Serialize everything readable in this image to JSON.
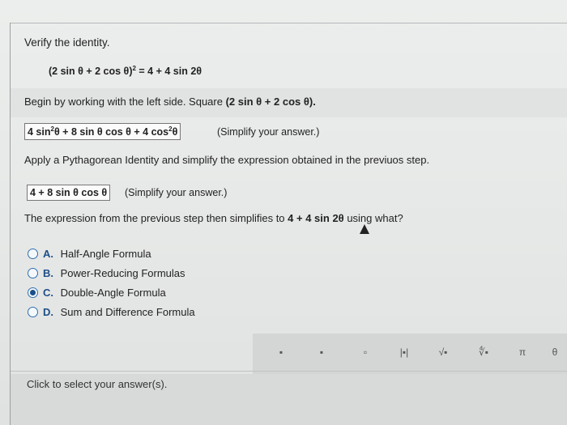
{
  "question": {
    "title": "Verify the identity.",
    "identity": {
      "lhs": "(2 sin θ + 2 cos θ)",
      "exp": "2",
      "rhs": " = 4 + 4 sin 2θ"
    }
  },
  "step1": {
    "prompt_prefix": "Begin by working with the left side. Square ",
    "prompt_expr": "(2 sin θ + 2 cos θ).",
    "answer_parts": [
      "4 sin",
      "2",
      "θ + 8 sin θ cos θ + 4 cos",
      "2",
      "θ"
    ],
    "hint": "(Simplify your answer.)"
  },
  "step2": {
    "prompt": "Apply a Pythagorean Identity and simplify the expression obtained in the previuos step.",
    "answer": "4 + 8 sin θ cos θ",
    "hint": "(Simplify your answer.)"
  },
  "step3": {
    "prompt_prefix": "The expression from the previous step then simplifies to ",
    "prompt_expr": "4 + 4 sin 2θ",
    "prompt_suffix": " using what?",
    "options": [
      {
        "letter": "A.",
        "label": "Half-Angle Formula",
        "selected": false
      },
      {
        "letter": "B.",
        "label": "Power-Reducing Formulas",
        "selected": false
      },
      {
        "letter": "C.",
        "label": "Double-Angle Formula",
        "selected": true
      },
      {
        "letter": "D.",
        "label": "Sum and Difference Formula",
        "selected": false
      }
    ]
  },
  "palette": {
    "buttons": [
      {
        "icon": "fraction-icon",
        "glyph": "▪"
      },
      {
        "icon": "mixed-number-icon",
        "glyph": "▪"
      },
      {
        "icon": "exponent-icon",
        "glyph": "▫"
      },
      {
        "icon": "absolute-value-icon",
        "glyph": "|▪|"
      },
      {
        "icon": "square-root-icon",
        "glyph": "√▪"
      },
      {
        "icon": "nth-root-icon",
        "glyph": "∜▪"
      },
      {
        "icon": "pi-icon",
        "glyph": "π"
      },
      {
        "icon": "theta-icon",
        "glyph": "θ"
      }
    ]
  },
  "footer": {
    "text": "Click to select your answer(s)."
  }
}
